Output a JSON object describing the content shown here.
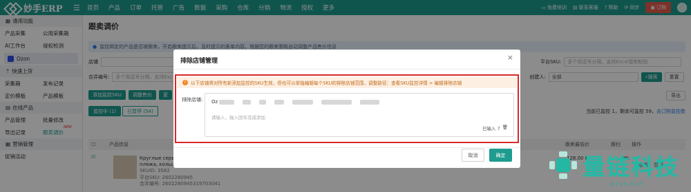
{
  "brand": {
    "logo_text": "妙手ERP"
  },
  "topnav": {
    "items": [
      "首页",
      "产品",
      "订单",
      "托管",
      "广告",
      "数据",
      "采购",
      "仓库",
      "分销",
      "物流",
      "授权",
      "更多"
    ]
  },
  "topright": {
    "training": "免费培训",
    "contact": "联系客服",
    "help": "帮助",
    "sync": "同步",
    "order": "订购"
  },
  "sidebar": {
    "sec_common": "通用功能",
    "row1": [
      "产品采集",
      "公用采集箱"
    ],
    "row2": [
      "AI工作台",
      "侵权检测"
    ],
    "ozon": "Ozon",
    "sec_quick": "快速上货",
    "row3": [
      "采集箱",
      "发布记录"
    ],
    "row4": [
      "定价模板",
      "产品模板"
    ],
    "sec_online": "在线产品",
    "row5": [
      "产品管理",
      "批量修改"
    ],
    "row6": [
      "导出记录",
      "跟卖调价"
    ],
    "sec_marketing": "营销管理",
    "row7": [
      "促销活动"
    ]
  },
  "main": {
    "title": "跟卖调价",
    "notice": "监控绑定的产品是否被跟卖，开启跟卖提示后，及时提示的表单内容，根据您的跟卖策略自动调整产品售价信息",
    "shop_label": "店铺",
    "platform_sku_label": "平台SKU:",
    "platform_sku_placeholder": "多个用逗号分隔，支持Excel复制粘贴",
    "merge_label": "合并编号:",
    "merge_placeholder": "多个用逗号分隔，支持Exc",
    "creator_label": "创建人:",
    "creator_value": "全部",
    "search_btn": "搜索",
    "reset_btn": "重置",
    "add_btn": "添加监控SKU",
    "adjust_btn": "调整售价",
    "more_btn": "更",
    "export_btn": "导出",
    "tab_monitoring": "监控中 (1)",
    "tab_paused": "已暂停 (54)",
    "status_text": "当前已监控 1，剩余可监控 59，",
    "status_link": "去订购监控数",
    "col_product": "产品信息",
    "col_min_price": "跟卖最低价",
    "col_rank": "跟扫",
    "col_ops": "操作",
    "product_title": "Круглые серь",
    "product_sub": "пляжа, кольца",
    "sku_id": "SKUID: 3582",
    "platform_sku": "平台SKU: 2602280945",
    "merge_no": "合并编号: 2602280945319703041",
    "price": "128.00 ₽",
    "rank": "98:",
    "op_view": "查看",
    "op_pause": "暂停"
  },
  "modal": {
    "title": "排除店铺管理",
    "close": "×",
    "warning": "以下店铺将对所有新添加监控的SKU生效，但也可以单独编辑每个SKU的排除店铺范围，调整路径：查看SKU监控详情 > 编辑排除店铺",
    "exclude_label": "排除店铺:",
    "first_shop": "Oz",
    "input_placeholder": "请输入，输入回车完成添加",
    "count_text": "已输入 7",
    "cancel": "取消",
    "confirm": "确定"
  },
  "watermark": {
    "title": "量链科技",
    "sub": "QFSP.NET"
  },
  "colors": {
    "brand": "#1d9c8f",
    "danger": "#d8262b",
    "warn_bg": "#fdf0e2",
    "watermark": "#24b8a4"
  }
}
